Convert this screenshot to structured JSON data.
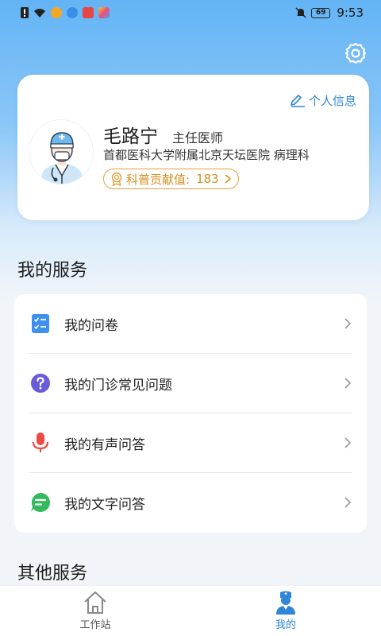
{
  "status_bar": {
    "battery": "69",
    "time": "9:53"
  },
  "header": {
    "settings_icon": "gear-icon"
  },
  "profile": {
    "edit_link": "个人信息",
    "name": "毛路宁",
    "title": "主任医师",
    "hospital": "首都医科大学附属北京天坛医院 病理科",
    "contribution_label": "科普贡献值:",
    "contribution_value": "183"
  },
  "my_services": {
    "title": "我的服务",
    "items": [
      {
        "label": "我的问卷",
        "icon": "questionnaire-icon",
        "color": "#3d8ff0"
      },
      {
        "label": "我的门诊常见问题",
        "icon": "question-icon",
        "color": "#6a5bd8"
      },
      {
        "label": "我的有声问答",
        "icon": "microphone-icon",
        "color": "#ee4b45"
      },
      {
        "label": "我的文字问答",
        "icon": "chat-icon",
        "color": "#35b95f"
      }
    ]
  },
  "other_services": {
    "title": "其他服务"
  },
  "tabbar": {
    "tabs": [
      {
        "label": "工作站",
        "icon": "home-icon",
        "active": false
      },
      {
        "label": "我的",
        "icon": "doctor-icon",
        "active": true
      }
    ]
  },
  "colors": {
    "accent": "#2f86d9",
    "contribution": "#e2a33e"
  }
}
